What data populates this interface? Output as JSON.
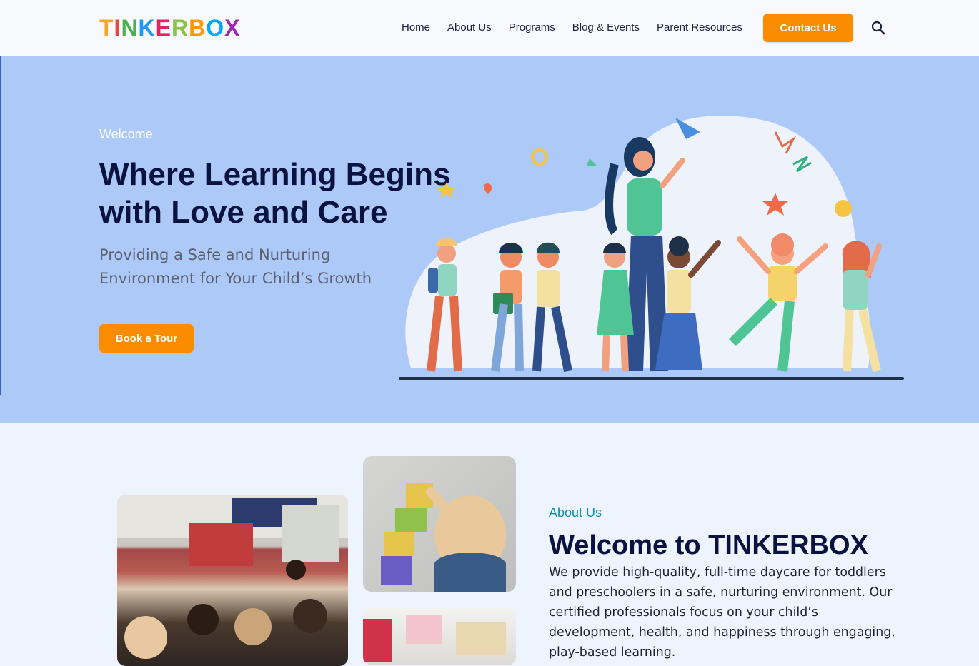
{
  "header": {
    "logo_letters": [
      "T",
      "I",
      "N",
      "K",
      "E",
      "R",
      "B",
      "O",
      "X"
    ],
    "logo_colors": [
      "#f5a623",
      "#e8453c",
      "#4caf50",
      "#2196f3",
      "#e91e63",
      "#8bc34a",
      "#ff9800",
      "#03a9f4",
      "#9c27b0"
    ],
    "nav": [
      "Home",
      "About Us",
      "Programs",
      "Blog & Events",
      "Parent Resources"
    ],
    "contact_label": "Contact Us",
    "search_icon": "search-icon"
  },
  "hero": {
    "eyebrow": "Welcome",
    "title": "Where Learning Begins with Love and Care",
    "subtitle": "Providing a Safe and Nurturing Environment for Your Child’s Growth",
    "cta_label": "Book a Tour",
    "illustration": "teacher-with-children-illustration"
  },
  "about": {
    "eyebrow": "About Us",
    "title": "Welcome to TINKERBOX",
    "body": "We provide high-quality, full-time daycare for toddlers and preschoolers in a safe, nurturing environment. Our certified professionals focus on your child’s development, health, and happiness through engaging, play-based learning.",
    "photos": [
      "classroom-photo",
      "toddler-blocks-photo",
      "play-kitchen-photo"
    ]
  },
  "colors": {
    "accent": "#fb8c00",
    "hero_bg": "#adc9f7",
    "heading": "#0a1340",
    "teal": "#0b8fa4"
  }
}
